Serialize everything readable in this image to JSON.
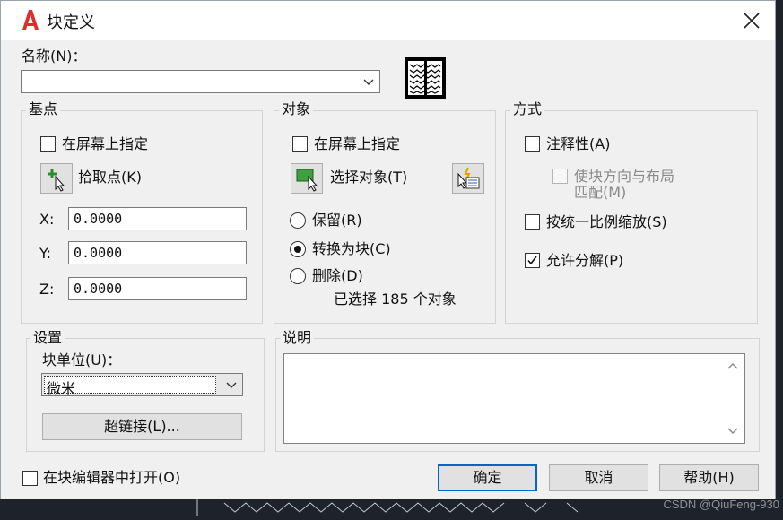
{
  "window": {
    "title": "块定义"
  },
  "name_field": {
    "label": "名称(N)：",
    "value": ""
  },
  "basepoint": {
    "group_label": "基点",
    "specify_on_screen": "在屏幕上指定",
    "pick_point": "拾取点(K)",
    "x_label": "X:",
    "x_value": "0.0000",
    "y_label": "Y:",
    "y_value": "0.0000",
    "z_label": "Z:",
    "z_value": "0.0000"
  },
  "objects": {
    "group_label": "对象",
    "specify_on_screen": "在屏幕上指定",
    "select_objects": "选择对象(T)",
    "retain": "保留(R)",
    "convert_to_block": "转换为块(C)",
    "delete": "删除(D)",
    "selected_count": "已选择 185 个对象"
  },
  "behavior": {
    "group_label": "方式",
    "annotative": "注释性(A)",
    "match_orientation_line1": "使块方向与布局",
    "match_orientation_line2": "匹配(M)",
    "scale_uniformly": "按统一比例缩放(S)",
    "allow_exploding": "允许分解(P)"
  },
  "settings": {
    "group_label": "设置",
    "block_unit_label": "块单位(U)：",
    "block_unit_value": "微米",
    "hyperlink_button": "超链接(L)..."
  },
  "description": {
    "group_label": "说明",
    "value": ""
  },
  "footer": {
    "open_in_editor": "在块编辑器中打开(O)",
    "ok": "确定",
    "cancel": "取消",
    "help": "帮助(H)"
  },
  "watermark": "CSDN @QiuFeng-930",
  "colors": {
    "accent": "#0a64c8",
    "app_icon": "#d9302b"
  }
}
